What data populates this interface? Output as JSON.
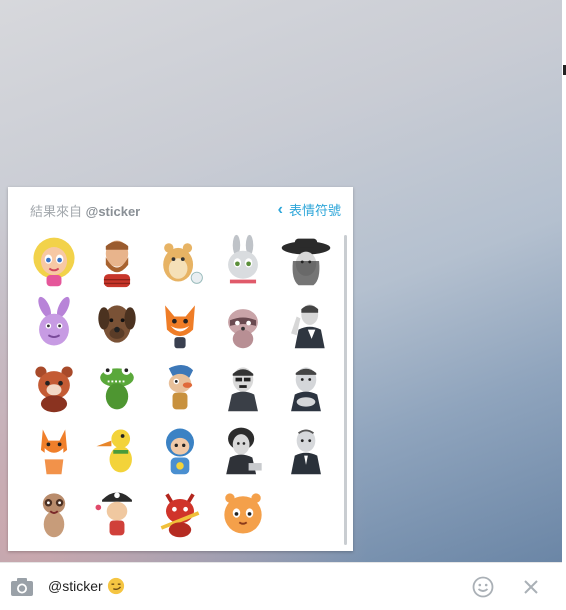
{
  "sticker_panel": {
    "results_prefix": "結果來自",
    "results_source": "@sticker",
    "back_label": "表情符號",
    "stickers": [
      {
        "name": "blonde-girl"
      },
      {
        "name": "bearded-man"
      },
      {
        "name": "hamster"
      },
      {
        "name": "bunny"
      },
      {
        "name": "woman-with-hat"
      },
      {
        "name": "purple-rabbit"
      },
      {
        "name": "dog"
      },
      {
        "name": "fox"
      },
      {
        "name": "raccoon"
      },
      {
        "name": "gentleman-gesture"
      },
      {
        "name": "red-panda"
      },
      {
        "name": "green-crocodile"
      },
      {
        "name": "cartoon-character"
      },
      {
        "name": "man-with-mustache"
      },
      {
        "name": "man-in-suit"
      },
      {
        "name": "white-fox"
      },
      {
        "name": "yellow-duck"
      },
      {
        "name": "blue-hood-kid"
      },
      {
        "name": "curly-hair-man"
      },
      {
        "name": "bald-man"
      },
      {
        "name": "meerkat"
      },
      {
        "name": "pirate-kid"
      },
      {
        "name": "red-devil"
      },
      {
        "name": "orange-puff"
      }
    ]
  },
  "composer": {
    "input_value": "@sticker",
    "input_emoji": "smirk-emoji",
    "camera_icon": "camera-icon",
    "emoji_icon": "smiley-icon",
    "close_icon": "close-icon"
  },
  "colors": {
    "accent": "#2ea6d9",
    "muted_text": "#a3a8ad"
  }
}
